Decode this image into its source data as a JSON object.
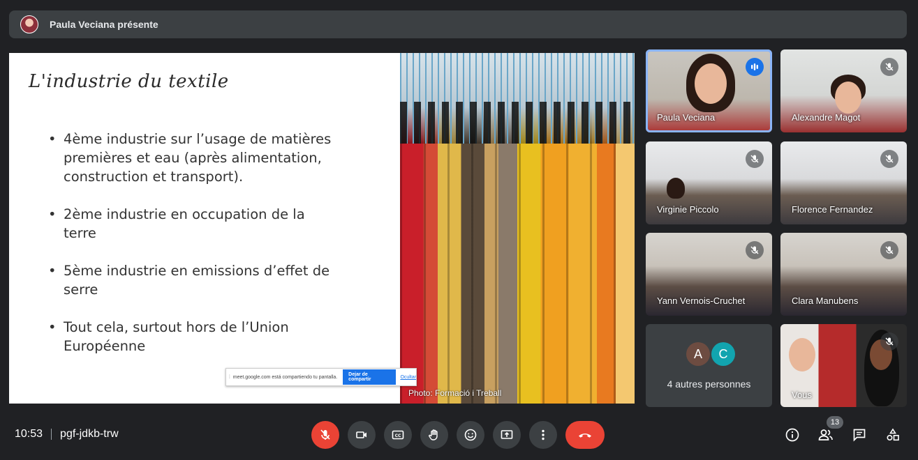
{
  "banner": {
    "text": "Paula Veciana présente"
  },
  "slide": {
    "title": "L'industrie du textile",
    "bullets": [
      "4ème industrie sur l’usage de matières premières et eau (après alimentation, construction et transport).",
      "2ème industrie en occupation de la terre",
      "5ème industrie en emissions d’effet de serre",
      "Tout cela, surtout hors de l’Union Européenne"
    ],
    "photo_credit": "Photo: Formació i Treball",
    "share_bar": {
      "message": "meet.google.com está compartiendo tu pantalla.",
      "stop_label": "Dejar de compartir",
      "hide_label": "Ocultar"
    }
  },
  "participants": [
    {
      "name": "Paula Veciana",
      "state": "speaking"
    },
    {
      "name": "Alexandre Magot",
      "state": "muted"
    },
    {
      "name": "Virginie Piccolo",
      "state": "muted"
    },
    {
      "name": "Florence Fernandez",
      "state": "muted"
    },
    {
      "name": "Yann Vernois-Cruchet",
      "state": "muted"
    },
    {
      "name": "Clara Manubens",
      "state": "muted"
    },
    {
      "name": "Vous",
      "state": "muted"
    }
  ],
  "others": {
    "initials": [
      "A",
      "C"
    ],
    "colors": [
      "#6d4c41",
      "#12a4af"
    ],
    "label": "4 autres personnes"
  },
  "bottom": {
    "time": "10:53",
    "meeting_code": "pgf-jdkb-trw",
    "participant_count": "13"
  },
  "colors": {
    "accent": "#8ab4f8",
    "danger": "#ea4335",
    "surface": "#3c4043",
    "background": "#202124"
  }
}
